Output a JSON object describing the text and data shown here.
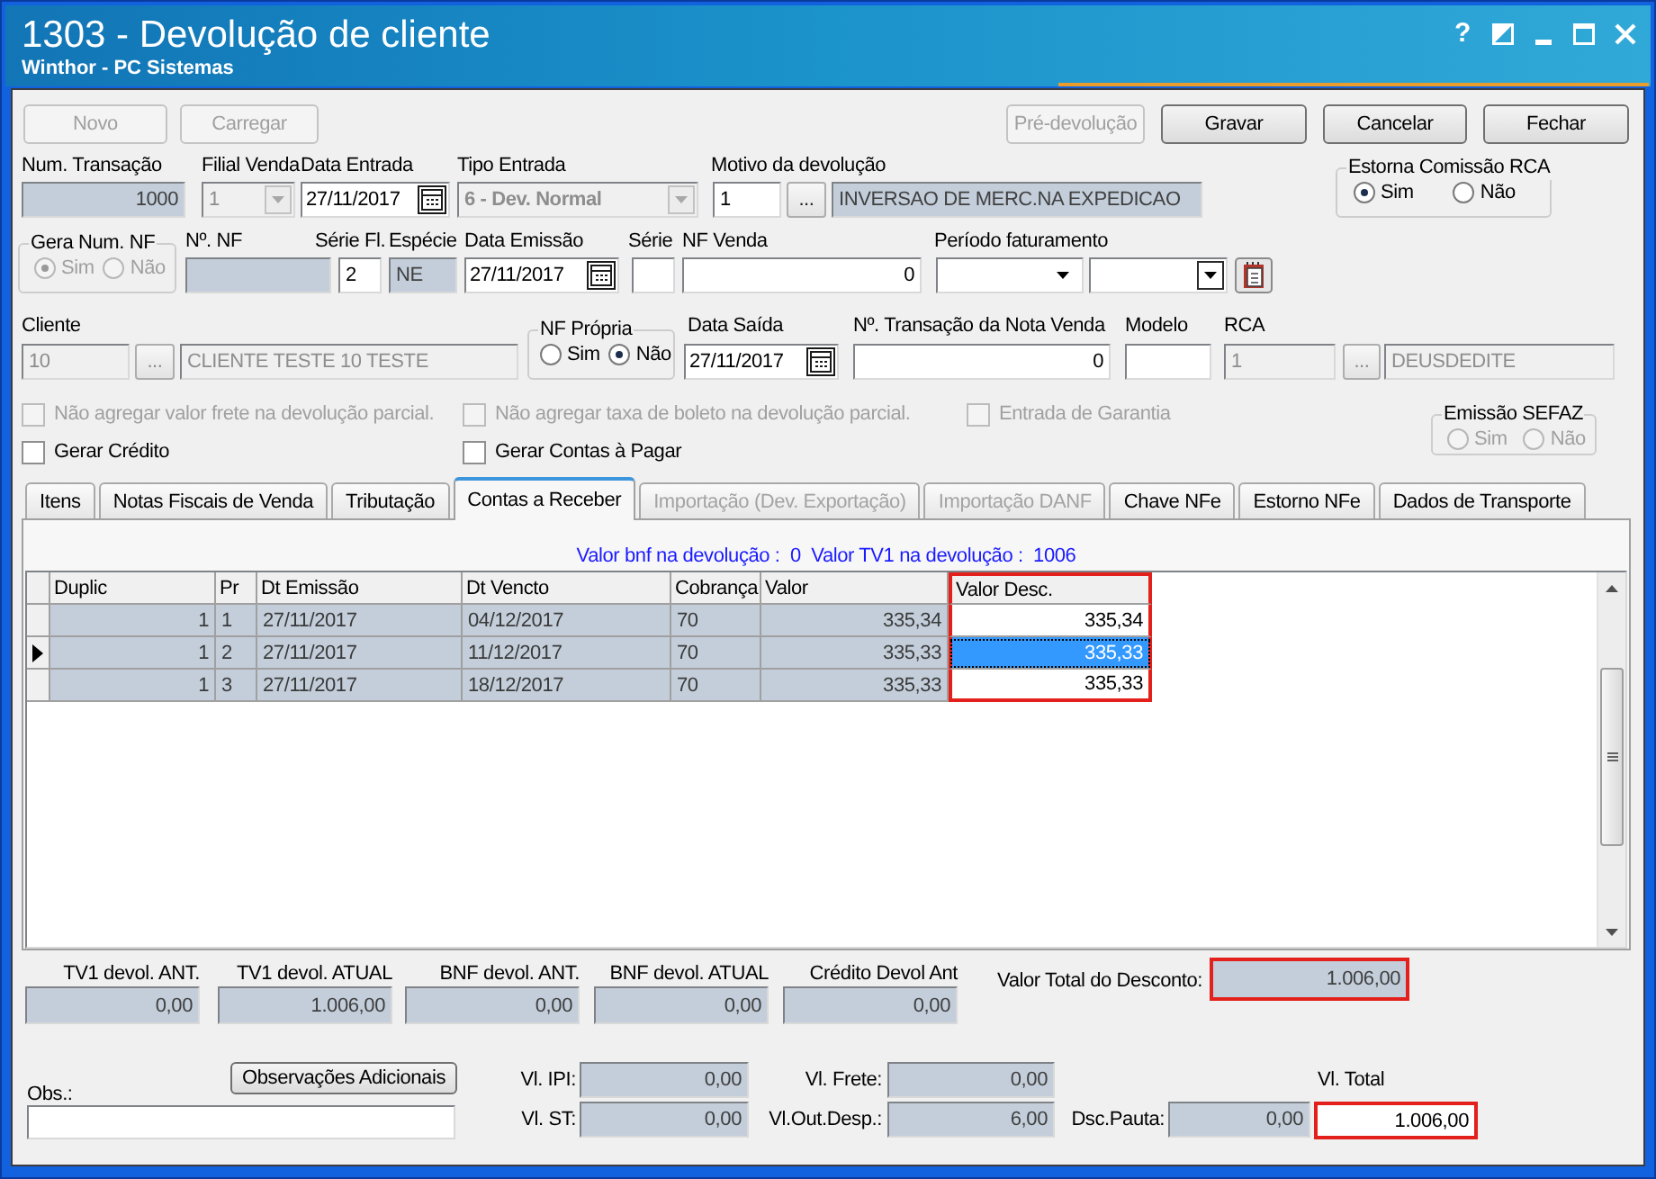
{
  "window": {
    "title": "1303 - Devolução de cliente",
    "subtitle": "Winthor - PC Sistemas",
    "help": "?"
  },
  "toolbar": {
    "left": [
      {
        "label": "Novo",
        "disabled": true
      },
      {
        "label": "Carregar",
        "disabled": true
      }
    ],
    "right": [
      {
        "label": "Pré-devolução",
        "disabled": true
      },
      {
        "label": "Gravar",
        "disabled": false
      },
      {
        "label": "Cancelar",
        "disabled": false
      },
      {
        "label": "Fechar",
        "disabled": false
      }
    ]
  },
  "header": {
    "num_transacao": {
      "label": "Num. Transação",
      "value": "1000",
      "readonly": true,
      "disabled": false
    },
    "filial_venda": {
      "label": "Filial Venda",
      "value": "1",
      "readonly": false,
      "disabled": true
    },
    "data_entrada": {
      "label": "Data Entrada",
      "value": "27/11/2017",
      "readonly": false,
      "disabled": false
    },
    "tipo_entrada": {
      "label": "Tipo Entrada",
      "value": "6 - Dev. Normal",
      "readonly": false,
      "disabled": true
    },
    "motivo": {
      "label": "Motivo da devolução",
      "code": {
        "value": "1",
        "readonly": false,
        "disabled": false
      },
      "lookup": "...",
      "description": {
        "value": "INVERSAO DE MERC.NA EXPEDICAO",
        "readonly": true,
        "disabled": false
      }
    },
    "estorna_comissao": {
      "label": "Estorna Comissão RCA",
      "disabled": false,
      "options": [
        {
          "label": "Sim",
          "selected": true
        },
        {
          "label": "Não",
          "selected": false
        }
      ]
    },
    "gera_num_nf": {
      "label": "Gera Num. NF",
      "disabled": true,
      "options": [
        {
          "label": "Sim",
          "selected": true
        },
        {
          "label": "Não",
          "selected": false
        }
      ]
    },
    "num_nf": {
      "label": "Nº. NF",
      "readonly": true
    },
    "serie_fl": {
      "label": "Série Fl.",
      "value": "2",
      "readonly": false,
      "disabled": false
    },
    "especie": {
      "label": "Espécie",
      "value": "NE",
      "readonly": true,
      "disabled": false
    },
    "data_emissao": {
      "label": "Data Emissão",
      "value": "27/11/2017",
      "readonly": false,
      "disabled": false
    },
    "serie": {
      "label": "Série",
      "readonly": false,
      "disabled": false
    },
    "nf_venda": {
      "label": "NF Venda",
      "value": "0",
      "readonly": false,
      "disabled": false
    },
    "periodo_faturamento": {
      "label": "Período faturamento",
      "start": {
        "readonly": false,
        "disabled": false
      },
      "end": {
        "readonly": false,
        "disabled": false
      }
    },
    "cliente": {
      "label": "Cliente",
      "code": {
        "value": "10",
        "readonly": false,
        "disabled": true
      },
      "lookup": "...",
      "name": {
        "value": "CLIENTE TESTE 10 TESTE",
        "readonly": false,
        "disabled": true
      }
    },
    "nf_propria": {
      "label": "NF Própria",
      "disabled": false,
      "options": [
        {
          "label": "Sim",
          "selected": false
        },
        {
          "label": "Não",
          "selected": true
        }
      ]
    },
    "data_saida": {
      "label": "Data Saída",
      "value": "27/11/2017",
      "readonly": false,
      "disabled": false
    },
    "transacao_nota_venda": {
      "label": "Nº. Transação da Nota Venda",
      "value": "0",
      "readonly": false,
      "disabled": false
    },
    "modelo": {
      "label": "Modelo",
      "readonly": false,
      "disabled": false
    },
    "rca": {
      "label": "RCA",
      "code": {
        "value": "1",
        "readonly": false,
        "disabled": true
      },
      "lookup": "...",
      "name": {
        "value": "DEUSDEDITE",
        "readonly": false,
        "disabled": true
      }
    }
  },
  "options": {
    "rows": [
      [
        {
          "label": "Não agregar valor frete na devolução parcial.",
          "checked": false,
          "disabled": true
        },
        {
          "label": "Não agregar taxa de boleto na devolução parcial.",
          "checked": false,
          "disabled": true
        },
        {
          "label": "Entrada de Garantia",
          "checked": false,
          "disabled": true
        }
      ],
      [
        {
          "label": "Gerar Crédito",
          "checked": false,
          "disabled": false
        },
        {
          "label": "Gerar Contas à Pagar",
          "checked": false,
          "disabled": false
        }
      ]
    ],
    "emissao_sefaz": {
      "label": "Emissão SEFAZ",
      "disabled": true,
      "options": [
        {
          "label": "Sim",
          "selected": false
        },
        {
          "label": "Não",
          "selected": false
        }
      ]
    }
  },
  "tabs": [
    {
      "label": "Itens",
      "selected": false,
      "disabled": false
    },
    {
      "label": "Notas Fiscais de Venda",
      "selected": false,
      "disabled": false
    },
    {
      "label": "Tributação",
      "selected": false,
      "disabled": false
    },
    {
      "label": "Contas a Receber",
      "selected": true,
      "disabled": false
    },
    {
      "label": "Importação (Dev. Exportação)",
      "selected": false,
      "disabled": true
    },
    {
      "label": "Importação DANF",
      "selected": false,
      "disabled": true
    },
    {
      "label": "Chave NFe",
      "selected": false,
      "disabled": false
    },
    {
      "label": "Estorno NFe",
      "selected": false,
      "disabled": false
    },
    {
      "label": "Dados de Transporte",
      "selected": false,
      "disabled": false
    }
  ],
  "contas_a_receber": {
    "summary": "Valor bnf na devolução :  0  Valor TV1 na devolução :  1006",
    "columns": [
      {
        "label": "Duplic",
        "editable": false,
        "highlighted": false
      },
      {
        "label": "Pr",
        "editable": false,
        "highlighted": false
      },
      {
        "label": "Dt Emissão",
        "editable": false,
        "highlighted": false
      },
      {
        "label": "Dt Vencto",
        "editable": false,
        "highlighted": false
      },
      {
        "label": "Cobrança",
        "editable": false,
        "highlighted": false
      },
      {
        "label": "Valor",
        "editable": false,
        "highlighted": false
      },
      {
        "label": "Valor Desc.",
        "editable": true,
        "highlighted": true
      }
    ],
    "rows": [
      {
        "selected": false,
        "cells": [
          "1",
          "1",
          "27/11/2017",
          "04/12/2017",
          "70",
          "335,34",
          "335,34"
        ]
      },
      {
        "selected": true,
        "cells": [
          "1",
          "2",
          "27/11/2017",
          "11/12/2017",
          "70",
          "335,33",
          "335,33"
        ]
      },
      {
        "selected": false,
        "cells": [
          "1",
          "3",
          "27/11/2017",
          "18/12/2017",
          "70",
          "335,33",
          "335,33"
        ]
      }
    ]
  },
  "totals": [
    {
      "label": "TV1 devol. ANT.",
      "value": "0,00",
      "readonly": true
    },
    {
      "label": "TV1 devol. ATUAL",
      "value": "1.006,00",
      "readonly": true
    },
    {
      "label": "BNF devol. ANT.",
      "value": "0,00",
      "readonly": true
    },
    {
      "label": "BNF devol. ATUAL",
      "value": "0,00",
      "readonly": true
    },
    {
      "label": "Crédito Devol Ant",
      "value": "0,00",
      "readonly": true
    }
  ],
  "desconto_total": {
    "label": "Valor Total do Desconto:",
    "value": "1.006,00",
    "readonly": true,
    "highlighted": true
  },
  "footer": {
    "obs_button": {
      "label": "Observações Adicionais",
      "disabled": false
    },
    "obs": {
      "label": "Obs.:",
      "readonly": false
    },
    "vl_ipi": {
      "label": "Vl. IPI:",
      "value": "0,00",
      "readonly": true
    },
    "vl_st": {
      "label": "Vl. ST:",
      "value": "0,00",
      "readonly": true
    },
    "vl_frete": {
      "label": "Vl. Frete:",
      "value": "0,00",
      "readonly": true
    },
    "vl_out_desp": {
      "label": "Vl.Out.Desp.:",
      "value": "6,00",
      "readonly": true
    },
    "dsc_pauta": {
      "label": "Dsc.Pauta:",
      "value": "0,00",
      "readonly": true
    },
    "vl_total": {
      "label": "Vl. Total",
      "value": "1.006,00",
      "readonly": false,
      "highlighted": true
    }
  }
}
